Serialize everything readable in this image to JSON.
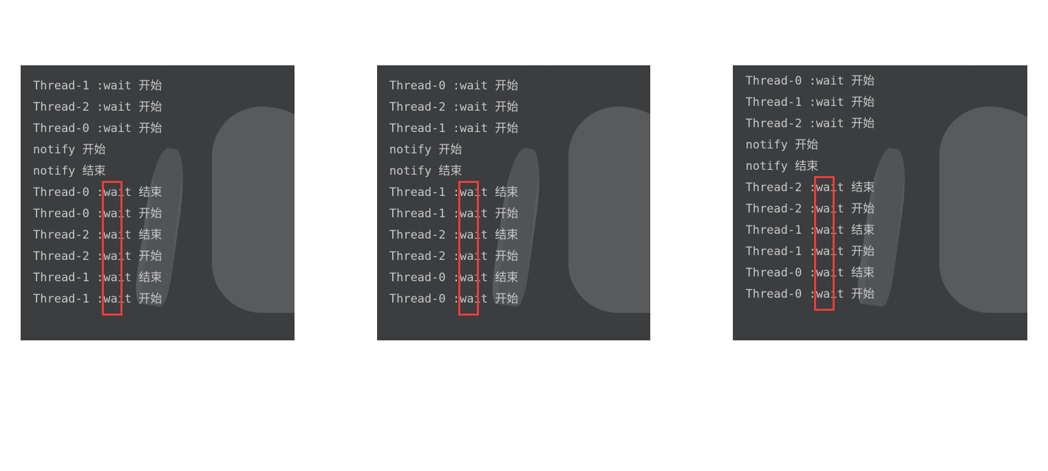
{
  "panels": [
    {
      "lines": [
        "Thread-1 :wait 开始",
        "Thread-2 :wait 开始",
        "Thread-0 :wait 开始",
        "notify 开始",
        "notify 结束",
        "Thread-0 :wait 结束",
        "Thread-0 :wait 开始",
        "Thread-2 :wait 结束",
        "Thread-2 :wait 开始",
        "Thread-1 :wait 结束",
        "Thread-1 :wait 开始"
      ]
    },
    {
      "lines": [
        "Thread-0 :wait 开始",
        "Thread-2 :wait 开始",
        "Thread-1 :wait 开始",
        "notify 开始",
        "notify 结束",
        "Thread-1 :wait 结束",
        "Thread-1 :wait 开始",
        "Thread-2 :wait 结束",
        "Thread-2 :wait 开始",
        "Thread-0 :wait 结束",
        "Thread-0 :wait 开始"
      ]
    },
    {
      "lines": [
        "Thread-0 :wait 开始",
        "Thread-1 :wait 开始",
        "Thread-2 :wait 开始",
        "notify 开始",
        "notify 结束",
        "Thread-2 :wait 结束",
        "Thread-2 :wait 开始",
        "Thread-1 :wait 结束",
        "Thread-1 :wait 开始",
        "Thread-0 :wait 结束",
        "Thread-0 :wait 开始"
      ]
    }
  ],
  "highlight_color": "#e93d3d"
}
